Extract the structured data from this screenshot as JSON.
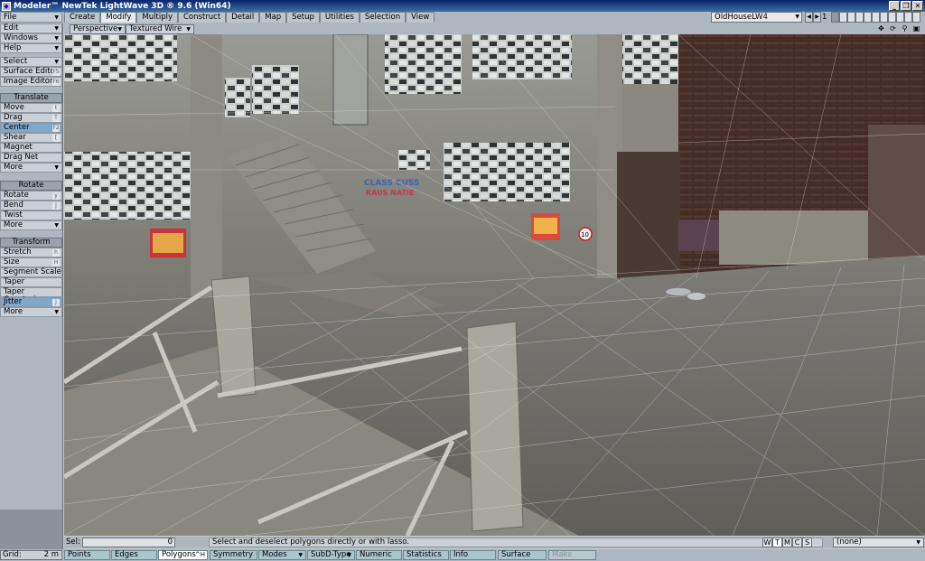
{
  "window": {
    "title": "Modeler™ NewTek LightWave 3D ® 9.6  (Win64)",
    "controls": [
      "_",
      "❐",
      "✕"
    ]
  },
  "tabs": [
    "Create",
    "Modify",
    "Multiply",
    "Construct",
    "Detail",
    "Map",
    "Setup",
    "Utilities",
    "Selection",
    "View"
  ],
  "active_tab": "Modify",
  "layer": {
    "name": "OldHouseLW4",
    "number": "1"
  },
  "sidebar": {
    "file": "File",
    "edit": "Edit",
    "windows": "Windows",
    "help": "Help",
    "select": "Select",
    "surface_editor": "Surface Editor",
    "surface_editor_key": "F5",
    "image_editor": "Image Editor",
    "image_editor_key": "F6",
    "translate_header": "Translate",
    "move": "Move",
    "move_key": "t",
    "drag": "Drag",
    "drag_key": "T",
    "center": "Center",
    "center_key": "F2",
    "shear": "Shear",
    "shear_key": "[",
    "magnet": "Magnet",
    "drag_net": "Drag Net",
    "more1": "More",
    "rotate_header": "Rotate",
    "rotate": "Rotate",
    "rotate_key": "y",
    "bend": "Bend",
    "bend_key": "J",
    "twist": "Twist",
    "more2": "More",
    "transform_header": "Transform",
    "stretch": "Stretch",
    "stretch_key": "h",
    "size": "Size",
    "size_key": "H",
    "segment_scale": "Segment Scale",
    "taper": "Taper",
    "taper_constrain": "Taper Constrain",
    "jitter": "Jitter",
    "jitter_key": "J",
    "more3": "More"
  },
  "viewport": {
    "view": "Perspective",
    "shading": "Textured Wire",
    "speed_sign": "10",
    "graffiti1": "CLASS CUSS",
    "graffiti2": "RAUS NATIE"
  },
  "status": {
    "sel_label": "Sel:",
    "sel_count": "0",
    "message": "Select and deselect polygons directly or with lasso.",
    "modes": [
      "W",
      "T",
      "M",
      "C",
      "S"
    ],
    "active_mode": "T",
    "surface_filter": "(none)"
  },
  "bottom": {
    "grid_label": "Grid:",
    "grid_value": "2 m",
    "points": "Points",
    "points_key": "^G",
    "edges": "Edges",
    "polygons": "Polygons",
    "polygons_key": "^H",
    "symmetry": "Symmetry",
    "modes": "Modes",
    "subd": "SubD-Type",
    "numeric": "Numeric",
    "statistics": "Statistics",
    "info": "Info",
    "surface": "Surface",
    "make": "Make"
  },
  "colors": {
    "title_bar": "#0a246a",
    "ui_gray": "#aeb6bf",
    "selected_button": "#7fa8cc",
    "bottom_button": "#a9c6cc"
  }
}
